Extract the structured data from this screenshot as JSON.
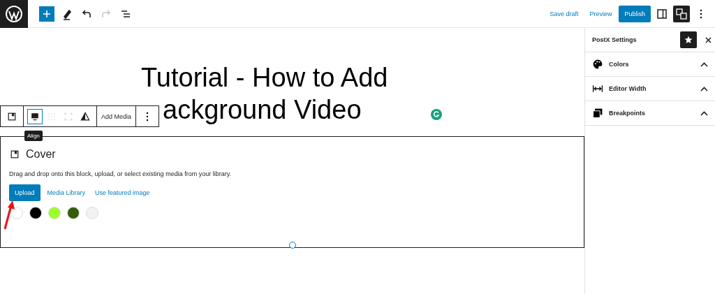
{
  "top_bar": {
    "tools": [
      {
        "kind": "add",
        "disabled": false
      },
      {
        "kind": "pen",
        "disabled": false
      },
      {
        "kind": "undo",
        "disabled": false
      },
      {
        "kind": "redo",
        "disabled": true
      },
      {
        "kind": "list",
        "disabled": false
      }
    ],
    "save_draft": "Save draft",
    "preview": "Preview",
    "publish": "Publish"
  },
  "post_title": [
    "Tutorial - How to Add",
    "ackground Video"
  ],
  "block_toolbar": {
    "tools": [
      {
        "kind": "cover",
        "selected": false,
        "disabled": false
      },
      {
        "kind": "align",
        "selected": true,
        "disabled": false
      },
      {
        "kind": "position",
        "selected": false,
        "disabled": true
      },
      {
        "kind": "fullsize",
        "selected": false,
        "disabled": true
      },
      {
        "kind": "contrast",
        "selected": false,
        "disabled": false
      }
    ],
    "add_media": "Add Media",
    "tooltip": "Align"
  },
  "cover_block": {
    "title": "Cover",
    "instructions": "Drag and drop onto this block, upload, or select existing media from your library.",
    "upload": "Upload",
    "media_library": "Media Library",
    "use_featured": "Use featured image",
    "swatches": [
      {
        "color": "#ffffff"
      },
      {
        "color": "#000000"
      },
      {
        "color": "#9cff29"
      },
      {
        "color": "#325d0b"
      },
      {
        "color": "#f2f2f2"
      }
    ]
  },
  "sidebar": {
    "title": "PostX Settings",
    "panels": [
      {
        "kind": "palette",
        "label": "Colors"
      },
      {
        "kind": "width",
        "label": "Editor Width"
      },
      {
        "kind": "breakpoints",
        "label": "Breakpoints"
      }
    ]
  }
}
